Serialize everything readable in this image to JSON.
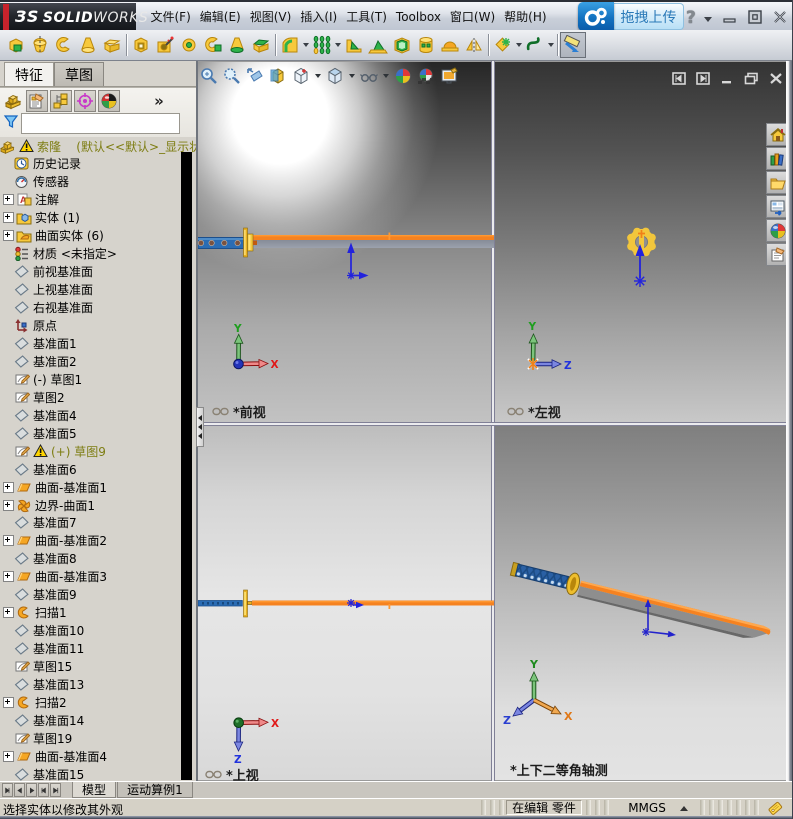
{
  "titlebar": {
    "logo_mark": "ЗS",
    "logo_bold": "SOLID",
    "logo_light": "WORKS",
    "menus": [
      "文件(F)",
      "编辑(E)",
      "视图(V)",
      "插入(I)",
      "工具(T)",
      "Toolbox",
      "窗口(W)",
      "帮助(H)"
    ],
    "upload_label": "拖拽上传"
  },
  "toolbar": {
    "items": [
      {
        "icon": "extruded-boss"
      },
      {
        "icon": "revolved-boss"
      },
      {
        "icon": "swept-boss"
      },
      {
        "icon": "lofted-boss"
      },
      {
        "icon": "boundary-boss"
      },
      {
        "sep": true
      },
      {
        "icon": "extruded-cut"
      },
      {
        "icon": "hole-wizard"
      },
      {
        "icon": "revolved-cut"
      },
      {
        "icon": "swept-cut"
      },
      {
        "icon": "lofted-cut"
      },
      {
        "icon": "boundary-cut"
      },
      {
        "sep": true
      },
      {
        "icon": "fillet",
        "arrow": true
      },
      {
        "icon": "linear-pattern",
        "arrow": true
      },
      {
        "icon": "rib"
      },
      {
        "icon": "draft"
      },
      {
        "icon": "shell"
      },
      {
        "icon": "wrap"
      },
      {
        "icon": "dome"
      },
      {
        "icon": "mirror"
      },
      {
        "sep": true
      },
      {
        "icon": "reference-geometry",
        "arrow": true
      },
      {
        "icon": "curves",
        "arrow": true
      },
      {
        "sep": true
      },
      {
        "icon": "instant3d",
        "pressed": true
      }
    ]
  },
  "left_panel": {
    "tabs": [
      {
        "label": "特征",
        "active": true
      },
      {
        "label": "草图",
        "active": false
      }
    ],
    "manager_icons": [
      "featuremanager",
      "propertymanager",
      "configurationmanager",
      "dimxpertmanager",
      "displaymanager"
    ],
    "more_label": "»",
    "tree": [
      {
        "label": "索隆    (默认<<默认>_显示状态",
        "icon": "part",
        "warn": true,
        "root": true,
        "olive": true
      },
      {
        "label": "历史记录",
        "icon": "history"
      },
      {
        "label": "传感器",
        "icon": "sensors"
      },
      {
        "label": "注解",
        "icon": "annotations",
        "plus": true
      },
      {
        "label": "实体 (1)",
        "icon": "solid-folder",
        "plus": true
      },
      {
        "label": "曲面实体 (6)",
        "icon": "surface-folder",
        "plus": true
      },
      {
        "label": "材质 <未指定>",
        "icon": "material"
      },
      {
        "label": "前视基准面",
        "icon": "plane"
      },
      {
        "label": "上视基准面",
        "icon": "plane"
      },
      {
        "label": "右视基准面",
        "icon": "plane"
      },
      {
        "label": "原点",
        "icon": "origin"
      },
      {
        "label": "基准面1",
        "icon": "plane"
      },
      {
        "label": "基准面2",
        "icon": "plane"
      },
      {
        "label": "(-) 草图1",
        "icon": "sketch"
      },
      {
        "label": "草图2",
        "icon": "sketch"
      },
      {
        "label": "基准面4",
        "icon": "plane"
      },
      {
        "label": "基准面5",
        "icon": "plane"
      },
      {
        "label": "(+) 草图9",
        "icon": "sketch",
        "warn": true,
        "olive": true
      },
      {
        "label": "基准面6",
        "icon": "plane"
      },
      {
        "label": "曲面-基准面1",
        "icon": "surface-plane",
        "plus": true
      },
      {
        "label": "边界-曲面1",
        "icon": "boundary-surface",
        "plus": true
      },
      {
        "label": "基准面7",
        "icon": "plane"
      },
      {
        "label": "曲面-基准面2",
        "icon": "surface-plane",
        "plus": true
      },
      {
        "label": "基准面8",
        "icon": "plane"
      },
      {
        "label": "曲面-基准面3",
        "icon": "surface-plane",
        "plus": true
      },
      {
        "label": "基准面9",
        "icon": "plane"
      },
      {
        "label": "扫描1",
        "icon": "sweep",
        "plus": true
      },
      {
        "label": "基准面10",
        "icon": "plane"
      },
      {
        "label": "基准面11",
        "icon": "plane"
      },
      {
        "label": "草图15",
        "icon": "sketch"
      },
      {
        "label": "基准面13",
        "icon": "plane"
      },
      {
        "label": "扫描2",
        "icon": "sweep",
        "plus": true
      },
      {
        "label": "基准面14",
        "icon": "plane"
      },
      {
        "label": "草图19",
        "icon": "sketch"
      },
      {
        "label": "曲面-基准面4",
        "icon": "surface-plane",
        "plus": true
      },
      {
        "label": "基准面15",
        "icon": "plane"
      }
    ]
  },
  "graphics": {
    "headsup_icons": [
      {
        "icon": "zoom-fit"
      },
      {
        "icon": "zoom-area"
      },
      {
        "icon": "previous-view"
      },
      {
        "icon": "section-view"
      },
      {
        "icon": "view-orientation",
        "arrow": true
      },
      {
        "icon": "display-style",
        "arrow": true
      },
      {
        "icon": "hide-show-items",
        "arrow": true
      },
      {
        "icon": "edit-appearance"
      },
      {
        "icon": "apply-scene"
      },
      {
        "icon": "view-settings"
      }
    ],
    "viewports": [
      {
        "label": "*前视",
        "chain": true
      },
      {
        "label": "*左视",
        "chain": true
      },
      {
        "label": "*上视",
        "chain": true
      },
      {
        "label": "*上下二等角轴测",
        "chain": false
      }
    ],
    "taskpane_icons": [
      "resources-home",
      "design-library",
      "file-explorer",
      "view-palette",
      "appearances-ball",
      "custom-properties"
    ]
  },
  "bottom_tabs": {
    "tabs": [
      {
        "label": "模型",
        "active": true
      },
      {
        "label": "运动算例1",
        "active": false
      }
    ]
  },
  "statusbar": {
    "message": "选择实体以修改其外观",
    "edit_state": "在编辑 零件",
    "units": "MMGS"
  }
}
